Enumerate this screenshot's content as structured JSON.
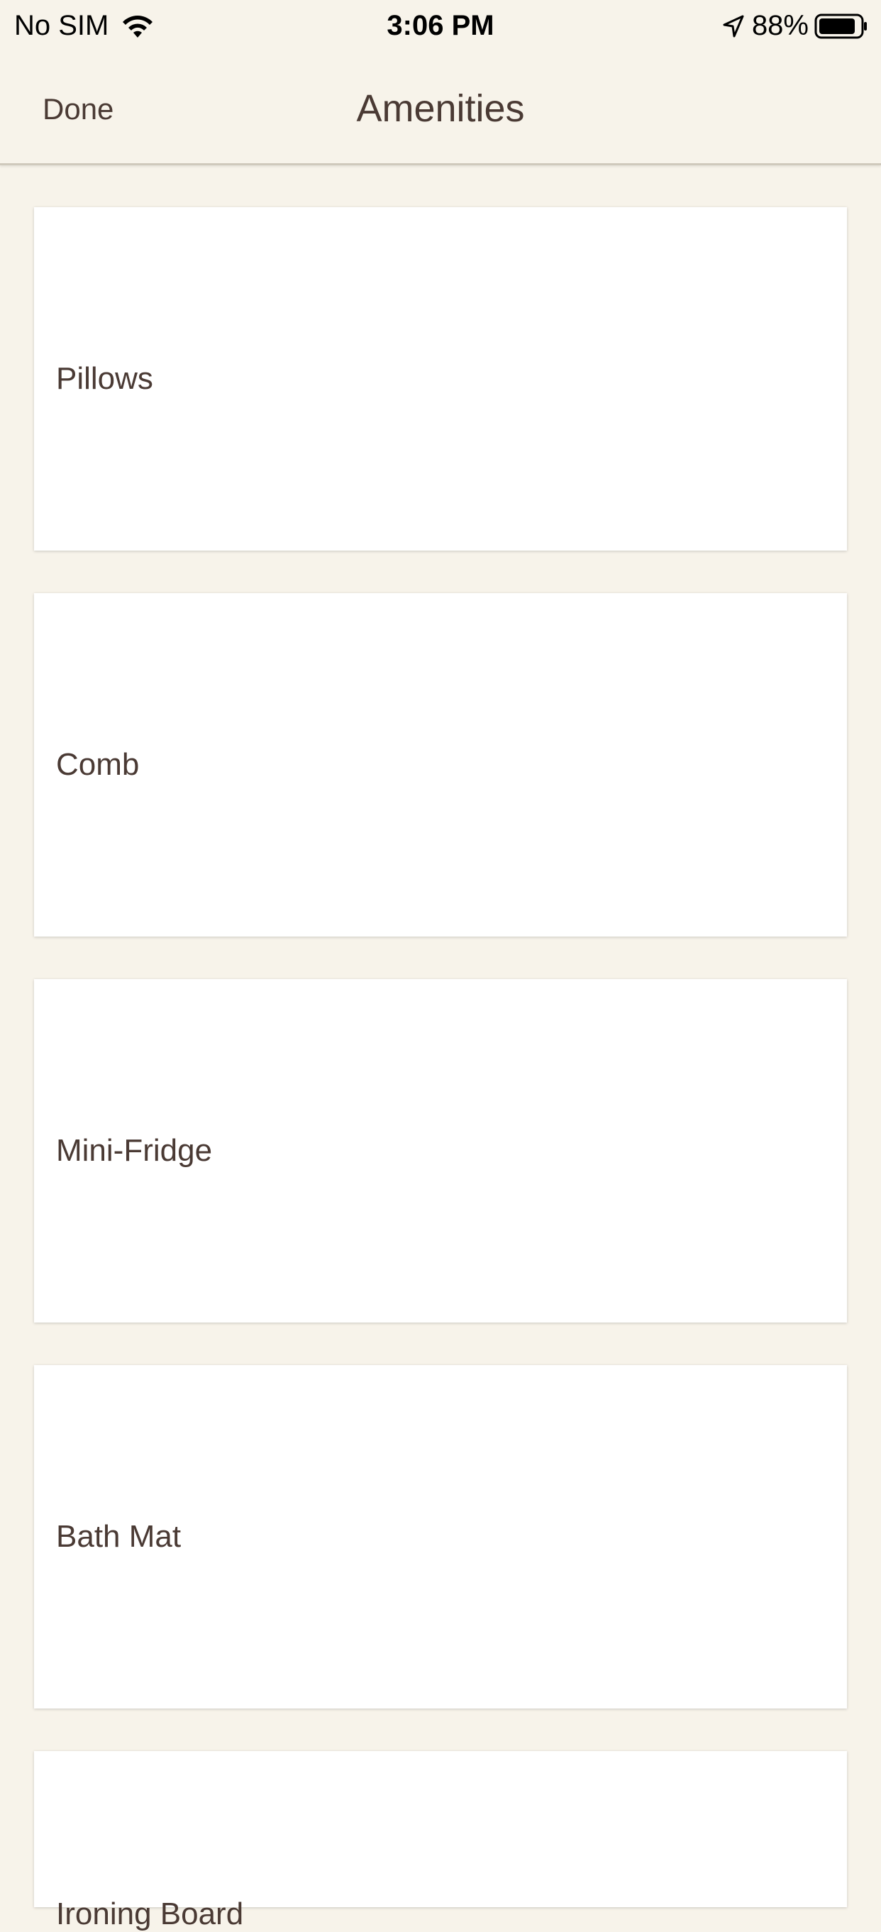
{
  "status_bar": {
    "carrier": "No SIM",
    "time": "3:06 PM",
    "battery": "88%"
  },
  "nav": {
    "done_label": "Done",
    "title": "Amenities"
  },
  "amenities": [
    {
      "label": "Pillows"
    },
    {
      "label": "Comb"
    },
    {
      "label": "Mini-Fridge"
    },
    {
      "label": "Bath Mat"
    },
    {
      "label": "Ironing Board"
    }
  ],
  "colors": {
    "background": "#f7f3ea",
    "card": "#ffffff",
    "text": "#4a3a34"
  }
}
